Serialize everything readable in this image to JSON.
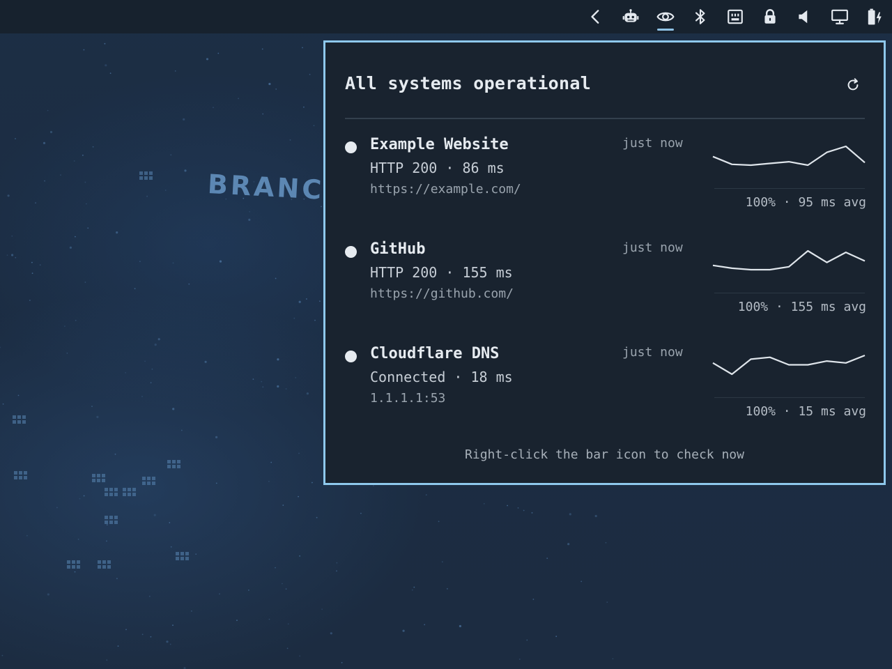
{
  "wallpaper": {
    "text": "BRANCH"
  },
  "tray": {
    "icons": [
      {
        "name": "chevron-left-icon",
        "active": false
      },
      {
        "name": "robot-icon",
        "active": false
      },
      {
        "name": "eye-icon",
        "active": true
      },
      {
        "name": "bluetooth-icon",
        "active": false
      },
      {
        "name": "network-icon",
        "active": false
      },
      {
        "name": "lock-icon",
        "active": false
      },
      {
        "name": "speaker-icon",
        "active": false
      },
      {
        "name": "monitor-icon",
        "active": false
      },
      {
        "name": "battery-charging-icon",
        "active": false
      }
    ]
  },
  "popup": {
    "title": "All systems operational",
    "services": [
      {
        "name": "Example Website",
        "status": "HTTP 200 · 86 ms",
        "target": "https://example.com/",
        "last_checked": "just now",
        "summary": "100% · 95 ms avg",
        "history_ms": [
          96,
          87,
          86,
          88,
          90,
          86,
          101,
          108,
          89
        ]
      },
      {
        "name": "GitHub",
        "status": "HTTP 200 · 155 ms",
        "target": "https://github.com/",
        "last_checked": "just now",
        "summary": "100% · 155 ms avg",
        "history_ms": [
          150,
          148,
          147,
          147,
          149,
          160,
          152,
          159,
          153
        ]
      },
      {
        "name": "Cloudflare DNS",
        "status": "Connected · 18 ms",
        "target": "1.1.1.1:53",
        "last_checked": "just now",
        "summary": "100% · 15 ms avg",
        "history_ms": [
          14,
          8,
          16,
          17,
          13,
          13,
          15,
          14,
          18
        ]
      }
    ],
    "footer": "Right-click the bar icon to check now"
  },
  "colors": {
    "accent": "#8ec8ec",
    "panel_bg": "#19232f",
    "bar_bg": "#17222e",
    "text": "#e6ebf0",
    "status_ok": "#e6ebf0"
  }
}
